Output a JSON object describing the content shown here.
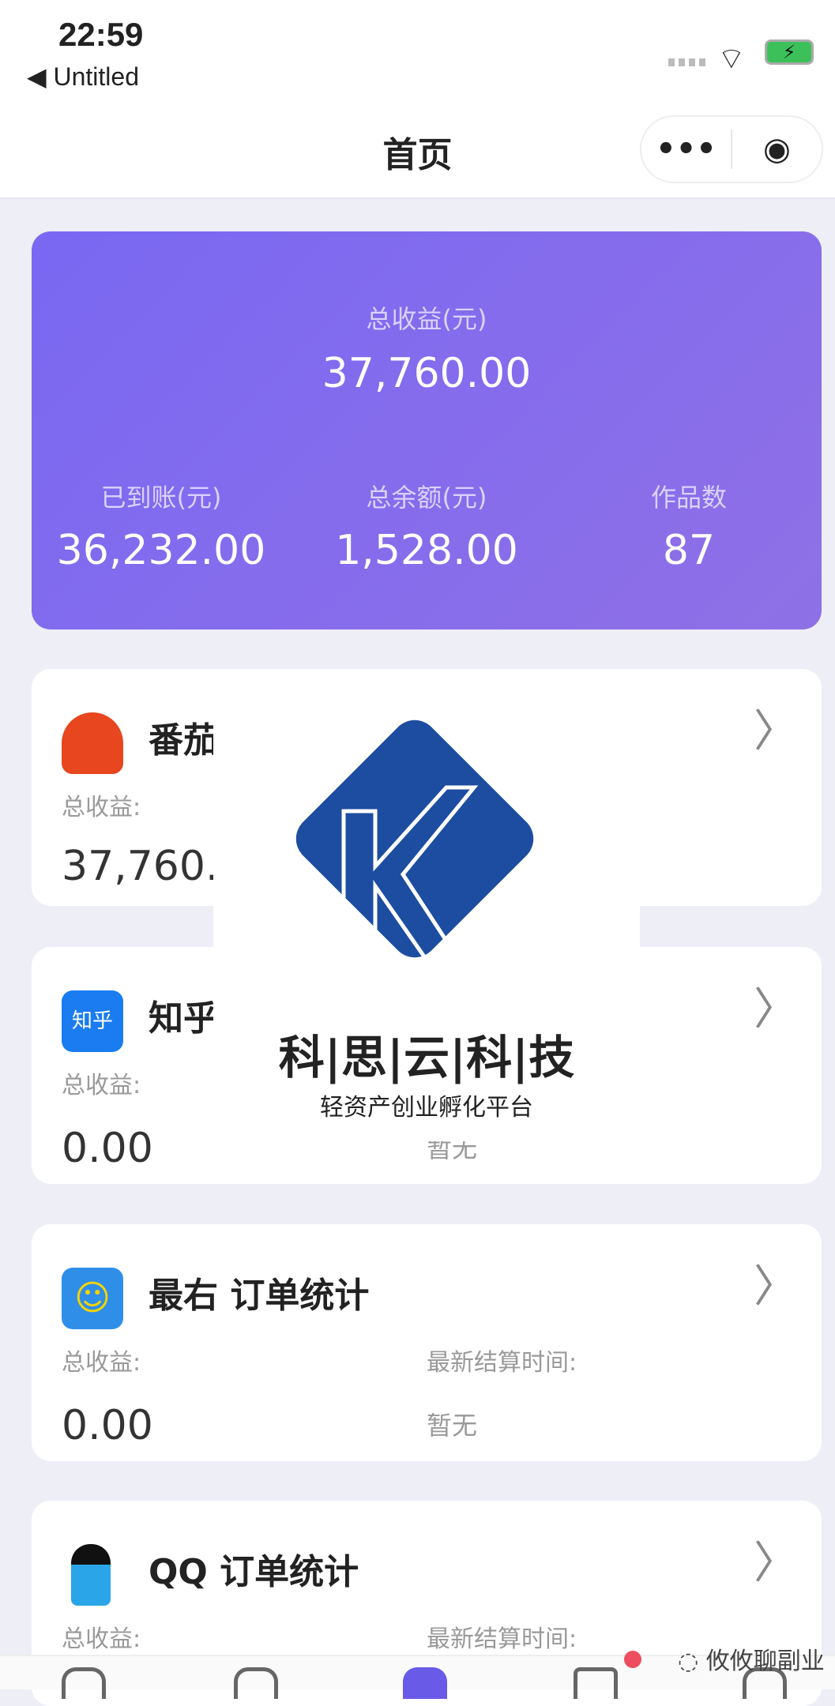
{
  "status_bar": {
    "time": "22:59",
    "back_label": "◀ Untitled",
    "wifi_icon": "wifi-icon",
    "battery_icon": "battery-charging-icon"
  },
  "nav": {
    "title": "首页",
    "more_icon": "•••",
    "close_icon": "◉"
  },
  "summary": {
    "accent": "#7a68f2",
    "total_label": "总收益(元)",
    "total_value": "37,760.00",
    "stats": [
      {
        "label": "已到账(元)",
        "value": "36,232.00"
      },
      {
        "label": "总余额(元)",
        "value": "1,528.00"
      },
      {
        "label": "作品数",
        "value": "87"
      }
    ]
  },
  "platforms": [
    {
      "title": "番茄",
      "icon": "tomato-app-icon",
      "earn_label": "总收益:",
      "earn_value": "37,760.",
      "time_label": "",
      "time_value": ""
    },
    {
      "title": "知乎",
      "icon": "zhihu-app-icon",
      "icon_text": "知乎",
      "earn_label": "总收益:",
      "earn_value": "0.00",
      "time_label": "",
      "time_value": "暂无"
    },
    {
      "title": "最右 订单统计",
      "icon": "zuiyou-app-icon",
      "earn_label": "总收益:",
      "earn_value": "0.00",
      "time_label": "最新结算时间:",
      "time_value": "暂无"
    },
    {
      "title": "QQ 订单统计",
      "icon": "qq-reading-app-icon",
      "earn_label": "总收益:",
      "earn_value": "",
      "time_label": "最新结算时间:",
      "time_value": ""
    }
  ],
  "watermark": {
    "brand": "科|思|云|科|技",
    "slogan": "轻资产创业孵化平台",
    "account": "攸攸聊副业"
  }
}
